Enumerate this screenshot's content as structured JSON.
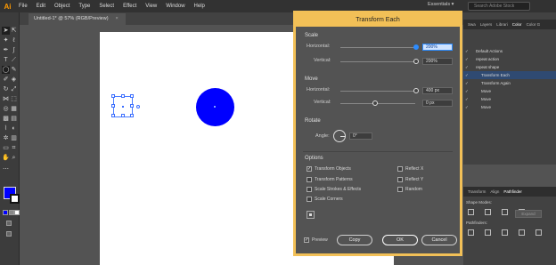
{
  "app": {
    "logo": "Ai"
  },
  "menu": [
    "File",
    "Edit",
    "Object",
    "Type",
    "Select",
    "Effect",
    "View",
    "Window",
    "Help"
  ],
  "workspace": "Essentials ▾",
  "search_placeholder": "Search Adobe Stock",
  "document_tab": {
    "title": "Untitled-1* @ 57% (RGB/Preview)",
    "close": "×"
  },
  "right_panel": {
    "tabs": [
      "Swa",
      "Layers",
      "Librari",
      "Color",
      "Color G"
    ],
    "active_tab": "Color",
    "actions": [
      {
        "label": "Default Actions",
        "highlight": false
      },
      {
        "label": "repeat action",
        "highlight": false
      },
      {
        "label": "repeat shape",
        "highlight": false
      },
      {
        "label": "Transform Each",
        "highlight": true
      },
      {
        "label": "Transform Again",
        "highlight": false
      },
      {
        "label": "Move",
        "highlight": false
      },
      {
        "label": "Move",
        "highlight": false
      },
      {
        "label": "Move",
        "highlight": false
      }
    ]
  },
  "pathfinder_panel": {
    "tabs": [
      "Transform",
      "Align",
      "Pathfinder"
    ],
    "active_tab": "Pathfinder",
    "shape_modes_label": "Shape Modes:",
    "pathfinders_label": "Pathfinders:",
    "expand_label": "Expand"
  },
  "dialog": {
    "title": "Transform Each",
    "scale": {
      "heading": "Scale",
      "horizontal_label": "Horizontal:",
      "horizontal_value": "200%",
      "vertical_label": "Vertical:",
      "vertical_value": "200%"
    },
    "move": {
      "heading": "Move",
      "horizontal_label": "Horizontal:",
      "horizontal_value": "400 px",
      "vertical_label": "Vertical:",
      "vertical_value": "0 px"
    },
    "rotate": {
      "heading": "Rotate",
      "angle_label": "Angle:",
      "angle_value": "0°"
    },
    "options": {
      "heading": "Options",
      "transform_objects": "Transform Objects",
      "transform_objects_checked": "✓",
      "transform_patterns": "Transform Patterns",
      "scale_strokes": "Scale Strokes & Effects",
      "scale_corners": "Scale Corners",
      "reflect_x": "Reflect X",
      "reflect_y": "Reflect Y",
      "random": "Random"
    },
    "preview_label": "Preview",
    "preview_checked": "✓",
    "copy_label": "Copy",
    "ok_label": "OK",
    "cancel_label": "Cancel"
  },
  "colors": {
    "accent": "#f2c057",
    "fill": "#0000ff",
    "highlight": "#2d8cff"
  }
}
